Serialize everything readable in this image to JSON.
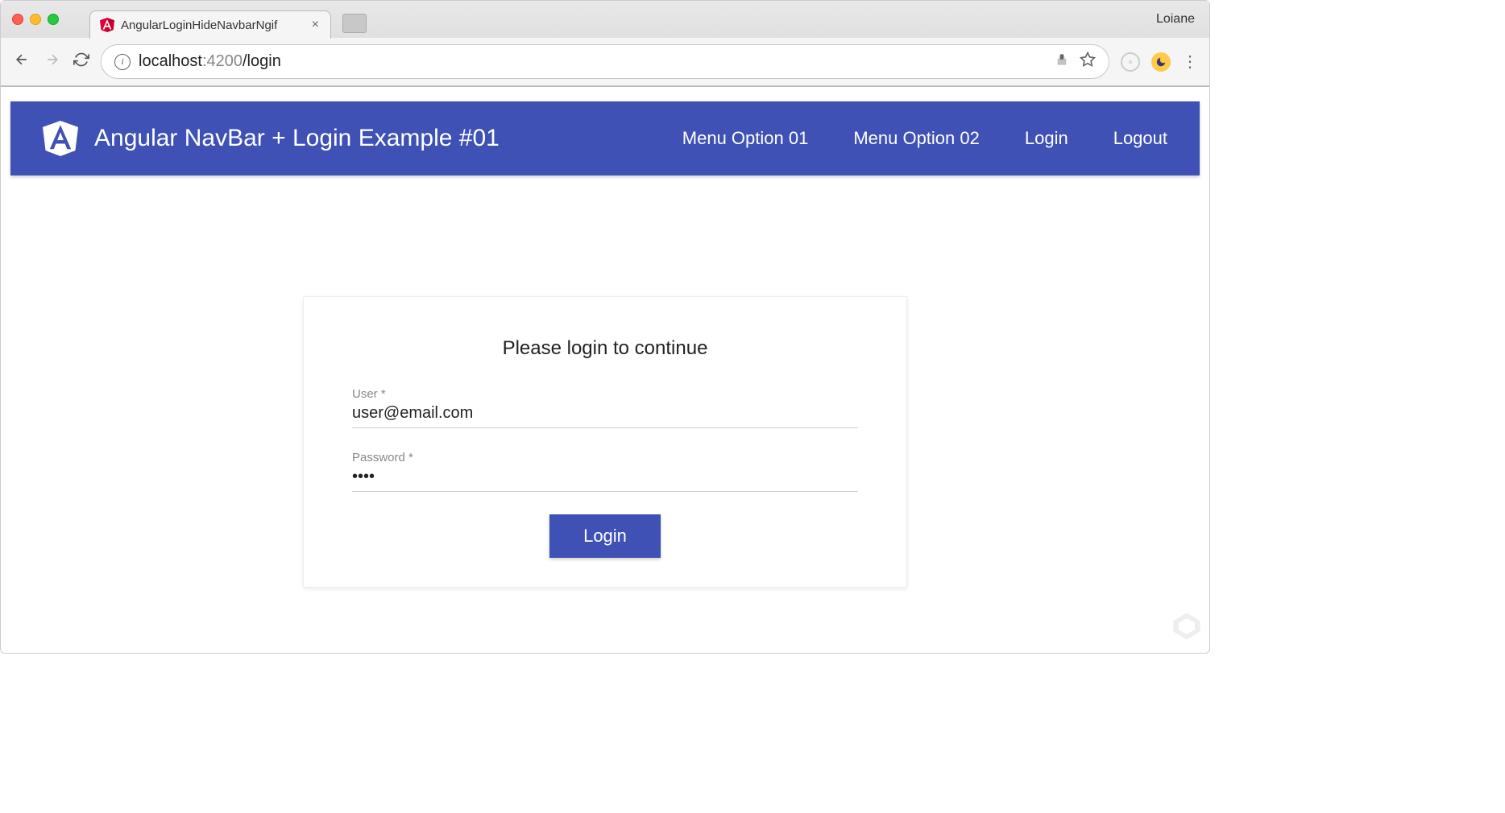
{
  "browser": {
    "tab_title": "AngularLoginHideNavbarNgif",
    "profile_name": "Loiane",
    "url_host": "localhost",
    "url_port": ":4200",
    "url_path": "/login"
  },
  "navbar": {
    "title": "Angular NavBar + Login Example #01",
    "menu": [
      "Menu Option 01",
      "Menu Option 02",
      "Login",
      "Logout"
    ]
  },
  "login": {
    "heading": "Please login to continue",
    "user_label": "User *",
    "user_value": "user@email.com",
    "password_label": "Password *",
    "password_value": "pass",
    "button_label": "Login"
  },
  "colors": {
    "primary": "#3f51b5"
  }
}
